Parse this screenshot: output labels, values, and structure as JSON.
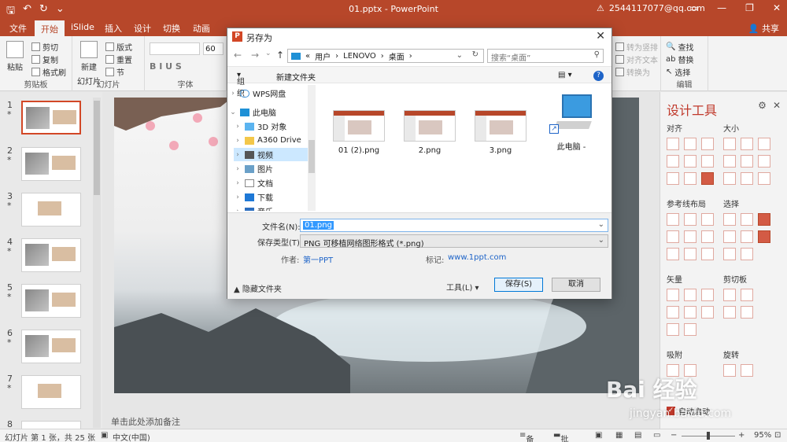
{
  "window": {
    "doc_title": "01.pptx - PowerPoint",
    "account": "2544117077@qq.com",
    "warning_icon": "warning-icon"
  },
  "tabs": [
    "文件",
    "开始",
    "iSlide",
    "插入",
    "设计",
    "切换",
    "动画"
  ],
  "active_tab": "开始",
  "share_label": "共享",
  "ribbon": {
    "clipboard": {
      "paste": "粘贴",
      "cut": "剪切",
      "copy": "复制",
      "format_painter": "格式刷",
      "group": "剪贴板"
    },
    "slides": {
      "new_slide": "新建",
      "new_slide2": "幻灯片",
      "layout": "版式",
      "reset": "重置",
      "section": "节",
      "group": "幻灯片"
    },
    "font": {
      "size": "60",
      "group": "字体"
    },
    "editing": {
      "find": "查找",
      "replace": "替换",
      "select": "选择",
      "group": "编辑"
    },
    "right_faded": [
      "转为竖排",
      "对齐文本",
      "转换为"
    ]
  },
  "thumbnails": [
    {
      "num": "1",
      "star": "*"
    },
    {
      "num": "2",
      "star": "*"
    },
    {
      "num": "3",
      "star": "*"
    },
    {
      "num": "4",
      "star": "*"
    },
    {
      "num": "5",
      "star": "*"
    },
    {
      "num": "6",
      "star": "*"
    },
    {
      "num": "7",
      "star": "*"
    },
    {
      "num": "8",
      "star": ""
    }
  ],
  "notes_placeholder": "单击此处添加备注",
  "design_panel": {
    "title": "设计工具",
    "sections": {
      "align": "对齐",
      "size": "大小",
      "guides": "参考线布局",
      "select": "选择",
      "vector": "矢量",
      "clipboard": "剪切板",
      "snap": "吸附",
      "rotate": "旋转"
    },
    "auto_start": "自动启动"
  },
  "status": {
    "slide_info": "幻灯片 第 1 张，共 25 张",
    "language": "中文(中国)",
    "notes": "备注",
    "comments": "批注",
    "zoom": "95%"
  },
  "dialog": {
    "title": "另存为",
    "breadcrumb": [
      "«",
      "用户",
      "LENOVO",
      "桌面"
    ],
    "search_placeholder": "搜索“桌面”",
    "organize": "组织",
    "new_folder": "新建文件夹",
    "tree": [
      {
        "label": "WPS网盘",
        "icon": "cloud-icon",
        "arrow": "›"
      },
      {
        "label": "此电脑",
        "icon": "computer-icon",
        "arrow": "⌄"
      },
      {
        "label": "3D 对象",
        "icon": "cube-icon",
        "arrow": "›"
      },
      {
        "label": "A360 Drive",
        "icon": "folder-icon",
        "arrow": "›"
      },
      {
        "label": "视频",
        "icon": "video-icon",
        "arrow": "›"
      },
      {
        "label": "图片",
        "icon": "picture-icon",
        "arrow": "›"
      },
      {
        "label": "文档",
        "icon": "document-icon",
        "arrow": "›"
      },
      {
        "label": "下载",
        "icon": "download-icon",
        "arrow": "›"
      },
      {
        "label": "音乐",
        "icon": "music-icon",
        "arrow": "›"
      }
    ],
    "files": [
      {
        "name": "01 (2).png"
      },
      {
        "name": "2.png"
      },
      {
        "name": "3.png"
      },
      {
        "name": "此电脑 -"
      }
    ],
    "filename_label": "文件名(N):",
    "filename_value": "01.png",
    "filetype_label": "保存类型(T):",
    "filetype_value": "PNG 可移植网络图形格式 (*.png)",
    "author_label": "作者:",
    "author_value": "第一PPT",
    "tags_label": "标记:",
    "tags_value": "www.1ppt.com",
    "hide_folders": "隐藏文件夹",
    "tools": "工具(L)",
    "save": "保存(S)",
    "cancel": "取消"
  },
  "watermark": {
    "text": "Bai 经验",
    "url": "jingyan.baidu.com"
  },
  "colors": {
    "brand": "#b7472a",
    "accent_blue": "#0078d7"
  }
}
